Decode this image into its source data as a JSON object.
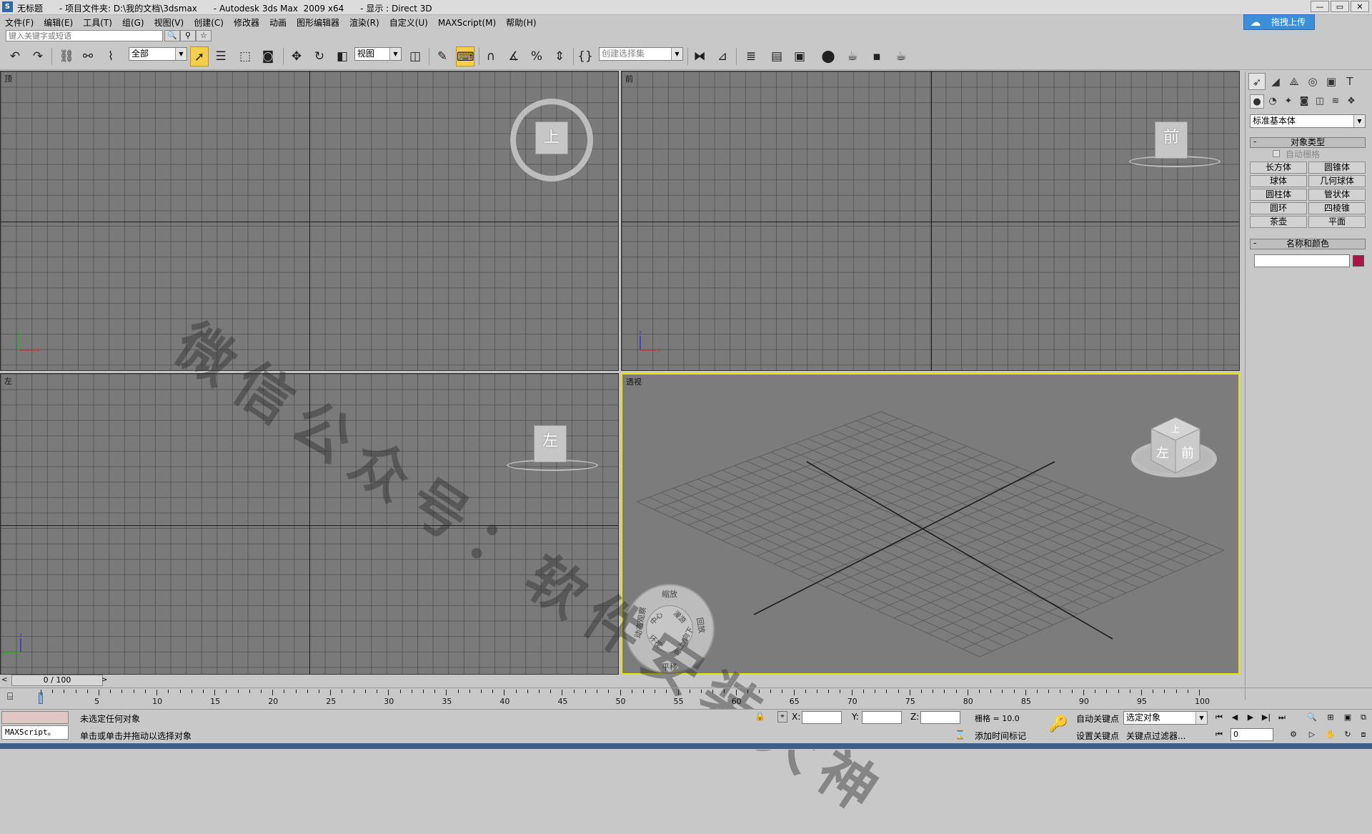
{
  "window": {
    "title": "无标题      - 项目文件夹: D:\\我的文档\\3dsmax      - Autodesk 3ds Max  2009 x64      - 显示 : Direct 3D",
    "controls": [
      "—",
      "▭",
      "✕"
    ]
  },
  "upload_button": {
    "label": "拖拽上传"
  },
  "menu": [
    "文件(F)",
    "编辑(E)",
    "工具(T)",
    "组(G)",
    "视图(V)",
    "创建(C)",
    "修改器",
    "动画",
    "图形编辑器",
    "渲染(R)",
    "自定义(U)",
    "MAXScript(M)",
    "帮助(H)"
  ],
  "search": {
    "placeholder": "键入关键字或短语"
  },
  "toolbar": {
    "selection_filter": "全部",
    "ref_coord": "视图",
    "named_selection": "创建选择集"
  },
  "viewports": {
    "top": {
      "label": "顶",
      "cube": "上"
    },
    "front": {
      "label": "前",
      "cube": "前"
    },
    "left": {
      "label": "左",
      "cube": "左"
    },
    "perspective": {
      "label": "透视",
      "cube_left": "左",
      "cube_front": "前",
      "cube_top": "上"
    }
  },
  "wheel": {
    "zoom": "缩放",
    "orbit": "动态观察",
    "center": "中心",
    "walk": "漫游",
    "look": "环视",
    "updown": "向上/向下",
    "rewind": "回放",
    "pan": "平移"
  },
  "watermark": "微信公众号：软件安装大神",
  "command_panel": {
    "category": "标准基本体",
    "object_type_header": "对象类型",
    "autogrid": "自动栅格",
    "objects": [
      "长方体",
      "圆锥体",
      "球体",
      "几何球体",
      "圆柱体",
      "管状体",
      "圆环",
      "四棱锥",
      "茶壶",
      "平面"
    ],
    "name_color_header": "名称和颜色",
    "object_color": "#a8164a"
  },
  "timeline": {
    "frame_display": "0 / 100",
    "ticks": [
      5,
      10,
      15,
      20,
      25,
      30,
      35,
      40,
      45,
      50,
      55,
      60,
      65,
      70,
      75,
      80,
      85,
      90,
      95,
      100
    ]
  },
  "status": {
    "maxscript": "MAXScript。",
    "selection_status": "未选定任何对象",
    "prompt": "单击或单击并拖动以选择对象",
    "x_label": "X:",
    "y_label": "Y:",
    "z_label": "Z:",
    "grid": "栅格 = 10.0",
    "auto_key": "自动关键点",
    "set_key": "设置关键点",
    "key_filter_select": "选定对象",
    "key_filters": "关键点过滤器...",
    "add_time_tag": "添加时间标记",
    "frame_field": "0"
  }
}
